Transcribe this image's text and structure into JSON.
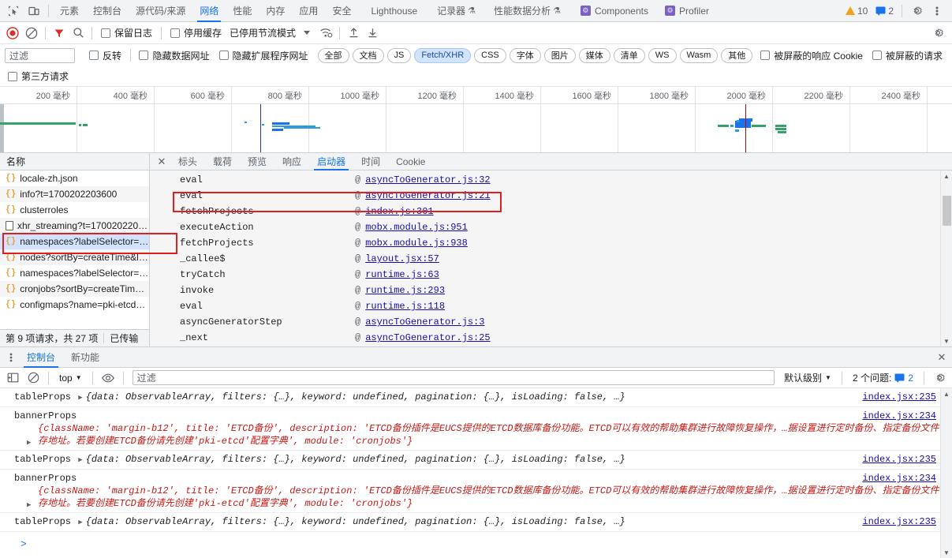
{
  "maintabs": {
    "icons": [
      {
        "name": "inspect-element-icon"
      },
      {
        "name": "device-toolbar-icon"
      }
    ],
    "tabs": [
      {
        "label": "元素",
        "selected": false
      },
      {
        "label": "控制台",
        "selected": false
      },
      {
        "label": "源代码/来源",
        "selected": false
      },
      {
        "label": "网络",
        "selected": true
      },
      {
        "label": "性能",
        "selected": false
      },
      {
        "label": "内存",
        "selected": false
      },
      {
        "label": "应用",
        "selected": false
      },
      {
        "label": "安全",
        "selected": false
      },
      {
        "label": "Lighthouse",
        "selected": false
      },
      {
        "label": "记录器",
        "selected": false,
        "flask": true
      },
      {
        "label": "性能数据分析",
        "selected": false,
        "flask": true
      },
      {
        "label": "Components",
        "selected": false,
        "react": true
      },
      {
        "label": "Profiler",
        "selected": false,
        "react": true
      }
    ],
    "warnings_count": "10",
    "issues_count": "2",
    "settings_icon": "gear-icon",
    "more_icon": "kebab-menu-icon"
  },
  "network_toolbar": {
    "record_icon": "record-stop-icon",
    "clear_icon": "clear-icon",
    "filter_icon": "filter-funnel-icon",
    "search_icon": "search-icon",
    "preserve_log": "保留日志",
    "disable_cache": "停用缓存",
    "throttling": "已停用节流模式",
    "wifi_icon": "network-conditions-icon",
    "import_icon": "import-har-icon",
    "export_icon": "export-har-icon",
    "settings_icon": "gear-icon"
  },
  "filter_row": {
    "filter_placeholder": "过滤",
    "invert": "反转",
    "hide_data_urls": "隐藏数据网址",
    "hide_extension_urls": "隐藏扩展程序网址",
    "types": [
      {
        "label": "全部",
        "selected": false
      },
      {
        "label": "文档",
        "selected": false
      },
      {
        "label": "JS",
        "selected": false
      },
      {
        "label": "Fetch/XHR",
        "selected": true
      },
      {
        "label": "CSS",
        "selected": false
      },
      {
        "label": "字体",
        "selected": false
      },
      {
        "label": "图片",
        "selected": false
      },
      {
        "label": "媒体",
        "selected": false
      },
      {
        "label": "清单",
        "selected": false
      },
      {
        "label": "WS",
        "selected": false
      },
      {
        "label": "Wasm",
        "selected": false
      },
      {
        "label": "其他",
        "selected": false
      }
    ],
    "blocked_cookies": "被屏蔽的响应 Cookie",
    "blocked_requests": "被屏蔽的请求",
    "third_party": "第三方请求"
  },
  "overview": {
    "ticks": [
      "200 毫秒",
      "400 毫秒",
      "600 毫秒",
      "800 毫秒",
      "1000 毫秒",
      "1200 毫秒",
      "1400 毫秒",
      "1600 毫秒",
      "1800 毫秒",
      "2000 毫秒",
      "2200 毫秒",
      "2400 毫秒"
    ]
  },
  "request_list": {
    "column_header": "名称",
    "rows": [
      {
        "name": "locale-zh.json",
        "icon": "json-icon",
        "selected": false
      },
      {
        "name": "info?t=1700202203600",
        "icon": "json-icon",
        "selected": false
      },
      {
        "name": "clusterroles",
        "icon": "json-icon",
        "selected": false
      },
      {
        "name": "xhr_streaming?t=170020220…",
        "icon": "document-icon",
        "selected": false
      },
      {
        "name": "namespaces?labelSelector=…",
        "icon": "json-icon",
        "selected": true
      },
      {
        "name": "nodes?sortBy=createTime&l…",
        "icon": "json-icon",
        "selected": false
      },
      {
        "name": "namespaces?labelSelector=…",
        "icon": "json-icon",
        "selected": false
      },
      {
        "name": "cronjobs?sortBy=createTim…",
        "icon": "json-icon",
        "selected": false
      },
      {
        "name": "configmaps?name=pki-etcd…",
        "icon": "json-icon",
        "selected": false
      }
    ],
    "footer_requests": "第 9 项请求，共 27 项",
    "footer_transferred": "已传输"
  },
  "detail": {
    "close_icon": "close-icon",
    "tabs": [
      {
        "label": "标头",
        "selected": false
      },
      {
        "label": "载荷",
        "selected": false
      },
      {
        "label": "预览",
        "selected": false
      },
      {
        "label": "响应",
        "selected": false
      },
      {
        "label": "启动器",
        "selected": true
      },
      {
        "label": "时间",
        "selected": false
      },
      {
        "label": "Cookie",
        "selected": false
      }
    ],
    "stack": [
      {
        "fn": "eval",
        "at": "@",
        "loc": "asyncToGenerator.js:32"
      },
      {
        "fn": "eval",
        "at": "@",
        "loc": "asyncToGenerator.js:21"
      },
      {
        "fn": "fetchProjects",
        "at": "@",
        "loc": "index.js:301"
      },
      {
        "fn": "executeAction",
        "at": "@",
        "loc": "mobx.module.js:951"
      },
      {
        "fn": "fetchProjects",
        "at": "@",
        "loc": "mobx.module.js:938"
      },
      {
        "fn": "_callee$",
        "at": "@",
        "loc": "layout.jsx:57"
      },
      {
        "fn": "tryCatch",
        "at": "@",
        "loc": "runtime.js:63"
      },
      {
        "fn": "invoke",
        "at": "@",
        "loc": "runtime.js:293"
      },
      {
        "fn": "eval",
        "at": "@",
        "loc": "runtime.js:118"
      },
      {
        "fn": "asyncGeneratorStep",
        "at": "@",
        "loc": "asyncToGenerator.js:3"
      },
      {
        "fn": "_next",
        "at": "@",
        "loc": "asyncToGenerator.js:25"
      }
    ]
  },
  "drawer": {
    "more_icon": "kebab-menu-icon",
    "tabs": [
      {
        "label": "控制台",
        "selected": true
      },
      {
        "label": "新功能",
        "selected": false
      }
    ],
    "close_icon": "close-icon",
    "toolbar": {
      "sidebar_icon": "console-sidebar-icon",
      "clear_icon": "clear-console-icon",
      "context": "top",
      "eye_icon": "live-expression-icon",
      "filter_placeholder": "过滤",
      "level": "默认级别",
      "issues_label": "2 个问题:",
      "issues_count": "2",
      "settings_icon": "gear-icon"
    },
    "messages": [
      {
        "type": "tableProps",
        "label": "tableProps",
        "preview_prefix": "{",
        "text": "data: ObservableArray, filters: {…}, keyword: undefined, pagination: {…}, isLoading: false, …}",
        "source": "index.jsx:235"
      },
      {
        "type": "bannerProps",
        "label": "bannerProps",
        "line1": "{className: 'margin-b12', title: 'ETCD备份', description: 'ETCD备份插件是EUCS提供的ETCD数据库备份功能。ETCD可以有效的帮助集群进行故障恢复操作，…据设置进行定时备份、指定备份文件保",
        "line2": "存地址。若要创建ETCD备份请先创建'pki-etcd'配置字典', module: 'cronjobs'}",
        "source": "index.jsx:234"
      },
      {
        "type": "tableProps",
        "label": "tableProps",
        "preview_prefix": "{",
        "text": "data: ObservableArray, filters: {…}, keyword: undefined, pagination: {…}, isLoading: false, …}",
        "source": "index.jsx:235"
      },
      {
        "type": "bannerProps",
        "label": "bannerProps",
        "line1": "{className: 'margin-b12', title: 'ETCD备份', description: 'ETCD备份插件是EUCS提供的ETCD数据库备份功能。ETCD可以有效的帮助集群进行故障恢复操作，…据设置进行定时备份、指定备份文件保",
        "line2": "存地址。若要创建ETCD备份请先创建'pki-etcd'配置字典', module: 'cronjobs'}",
        "source": "index.jsx:234"
      },
      {
        "type": "tableProps",
        "label": "tableProps",
        "preview_prefix": "{",
        "text": "data: ObservableArray, filters: {…}, keyword: undefined, pagination: {…}, isLoading: false, …}",
        "source": "index.jsx:235"
      }
    ],
    "prompt_caret": ">"
  },
  "colors": {
    "accent": "#1a73e8",
    "annotation": "#e02020",
    "selection": "#d3e3fd",
    "link": "#1a0dab",
    "string": "#c41a16",
    "warning": "#f2a11b"
  }
}
